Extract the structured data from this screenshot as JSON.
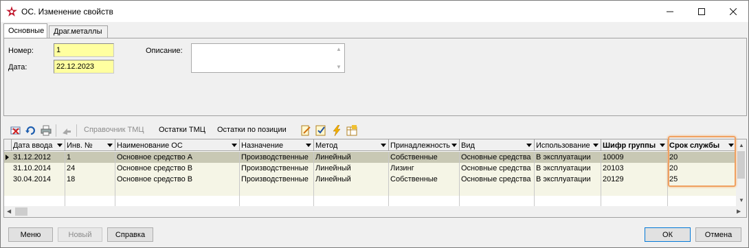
{
  "window": {
    "title": "ОС. Изменение свойств",
    "icon": "star-app-icon",
    "controls": [
      "minimize",
      "maximize",
      "close"
    ]
  },
  "tabs": [
    {
      "label": "Основные",
      "active": true
    },
    {
      "label": "Драг.металлы",
      "active": false
    }
  ],
  "form": {
    "number_label": "Номер:",
    "number_value": "1",
    "date_label": "Дата:",
    "date_value": "22.12.2023",
    "description_label": "Описание:",
    "description_value": ""
  },
  "toolbar": {
    "items": [
      {
        "icon": "delete-icon"
      },
      {
        "icon": "refresh-icon"
      },
      {
        "icon": "print-icon"
      },
      {
        "icon": "disabled-action-icon"
      },
      {
        "label": "Справочник ТМЦ",
        "enabled": false
      },
      {
        "label": "Остатки ТМЦ",
        "enabled": true
      },
      {
        "label": "Остатки по позиции",
        "enabled": true
      },
      {
        "icon": "edit-doc-icon"
      },
      {
        "icon": "checklist-icon"
      },
      {
        "icon": "lightning-icon"
      },
      {
        "icon": "table-edit-icon"
      }
    ]
  },
  "grid": {
    "columns": [
      {
        "label": "Дата ввода",
        "bold": false
      },
      {
        "label": "Инв. №",
        "bold": false
      },
      {
        "label": "Наименование ОС",
        "bold": false
      },
      {
        "label": "Назначение",
        "bold": false
      },
      {
        "label": "Метод",
        "bold": false
      },
      {
        "label": "Принадлежность",
        "bold": false
      },
      {
        "label": "Вид",
        "bold": false
      },
      {
        "label": "Использование",
        "bold": false
      },
      {
        "label": "Шифр группы",
        "bold": true
      },
      {
        "label": "Срок службы",
        "bold": true
      }
    ],
    "rows": [
      [
        "31.12.2012",
        "1",
        "Основное средство А",
        "Производственные",
        "Линейный",
        "Собственные",
        "Основные средства",
        "В эксплуатации",
        "10009",
        "20"
      ],
      [
        "31.10.2014",
        "24",
        "Основное средство В",
        "Производственные",
        "Линейный",
        "Лизинг",
        "Основные средства",
        "В эксплуатации",
        "20103",
        "20"
      ],
      [
        "30.04.2014",
        "18",
        "Основное средство В",
        "Производственные",
        "Линейный",
        "Собственные",
        "Основные средства",
        "В эксплуатации",
        "20129",
        "25"
      ]
    ],
    "selected_row": 0,
    "highlight_color": "#f0a060"
  },
  "buttons": {
    "menu": "Меню",
    "new": "Новый",
    "help": "Справка",
    "ok": "ОК",
    "cancel": "Отмена"
  }
}
